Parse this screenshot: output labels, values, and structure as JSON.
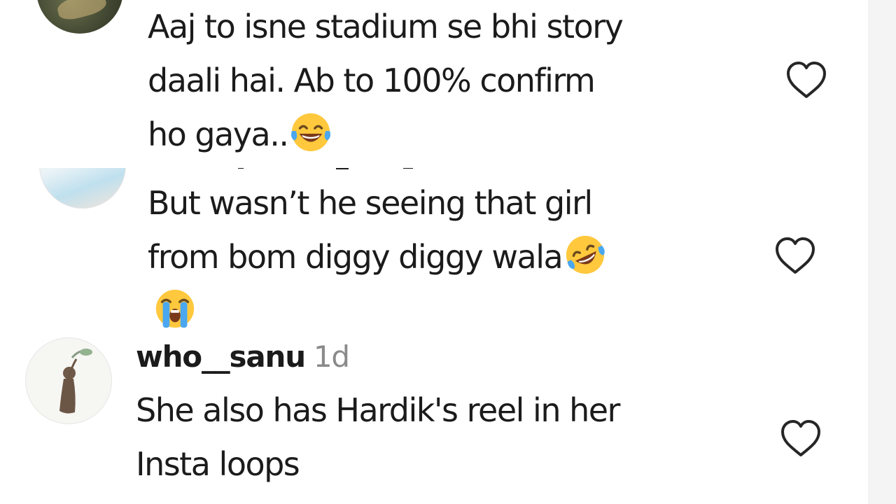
{
  "comments": [
    {
      "text": "Aaj to isne stadium se bhi story\ndaali hai. Ab to 100% confirm\nho gaya..",
      "emoji": [
        "face-with-tears-of-joy-icon"
      ],
      "liked": false
    },
    {
      "text": "But wasn’t he seeing that girl\nfrom bom diggy diggy wala",
      "emoji": [
        "rolling-on-the-floor-laughing-icon",
        "loudly-crying-face-icon"
      ],
      "liked": false
    },
    {
      "username": "who__sanu",
      "timestamp": "1d",
      "text": "She also has Hardik's reel in her\nInsta loops",
      "liked": false
    }
  ],
  "colors": {
    "text": "#1b1b1b",
    "timestamp": "#8a8a8a",
    "heart_outline": "#262626",
    "emoji_yellow": "#ffc83d"
  }
}
